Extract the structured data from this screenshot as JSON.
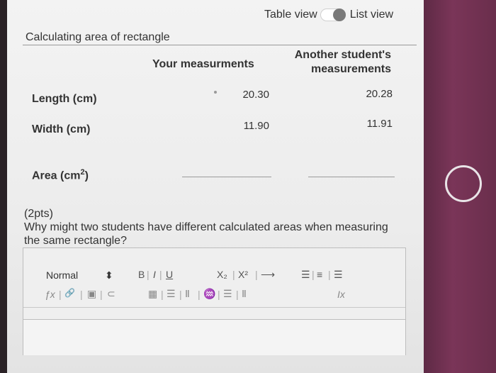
{
  "view_toggle": {
    "left_label": "Table view",
    "right_label": "List view"
  },
  "section": {
    "title": "Calculating area of rectangle"
  },
  "table": {
    "col_a": "Your measurments",
    "col_b_line1": "Another student's",
    "col_b_line2": "measurements",
    "rows": [
      {
        "label": "Length (cm)",
        "a": "20.30",
        "b": "20.28"
      },
      {
        "label": "Width (cm)",
        "a": "11.90",
        "b": "11.91"
      }
    ],
    "area_label": "Area (cm",
    "area_sup": "2",
    "area_close": ")"
  },
  "question": {
    "points": "(2pts)",
    "text": "Why might two students have different calculated areas when measuring the same rectangle?"
  },
  "editor": {
    "format_select": "Normal",
    "select_arrow": "⬍",
    "bold": "B",
    "italic": "I",
    "underline": "U",
    "subscript": "X₂",
    "superscript": "X²",
    "arrow": "⟶",
    "ordered_list": "☰",
    "bullet_list": "≡",
    "align": "☰",
    "formula": "ƒx",
    "link": "🔗",
    "image": "▣",
    "attach": "⊂",
    "table": "▦",
    "indent": "☰",
    "outdent": "Ⅱ",
    "special": "♒",
    "align_center": "☰",
    "clear_format": "Ⅱ",
    "remove_format": "Ix"
  }
}
